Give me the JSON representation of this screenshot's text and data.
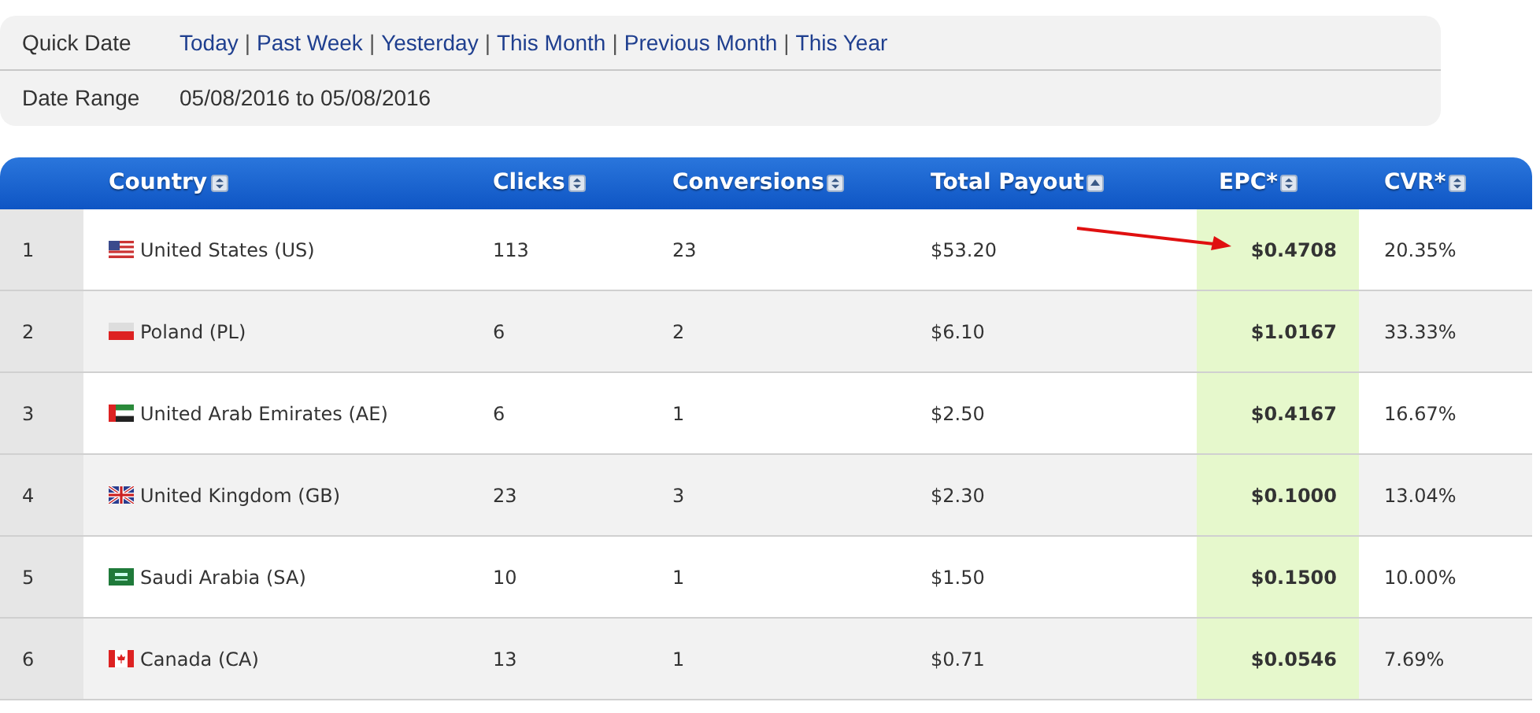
{
  "filters": {
    "quick_date": {
      "label": "Quick Date",
      "links": [
        "Today",
        "Past Week",
        "Yesterday",
        "This Month",
        "Previous Month",
        "This Year"
      ],
      "separator": "|"
    },
    "date_range": {
      "label": "Date Range",
      "value": "05/08/2016 to 05/08/2016"
    }
  },
  "table": {
    "columns": [
      {
        "label": "Country",
        "sorted": false,
        "highlighted": false
      },
      {
        "label": "Clicks",
        "sorted": false,
        "highlighted": false
      },
      {
        "label": "Conversions",
        "sorted": false,
        "highlighted": false
      },
      {
        "label": "Total Payout",
        "sorted": true,
        "highlighted": false
      },
      {
        "label": "EPC*",
        "sorted": false,
        "highlighted": true
      },
      {
        "label": "CVR*",
        "sorted": false,
        "highlighted": false
      }
    ],
    "rows": [
      {
        "rank": "1",
        "country": "United States (US)",
        "clicks": "113",
        "conversions": "23",
        "total_payout": "$53.20",
        "epc": "$0.4708",
        "cvr": "20.35%"
      },
      {
        "rank": "2",
        "country": "Poland (PL)",
        "clicks": "6",
        "conversions": "2",
        "total_payout": "$6.10",
        "epc": "$1.0167",
        "cvr": "33.33%"
      },
      {
        "rank": "3",
        "country": "United Arab Emirates (AE)",
        "clicks": "6",
        "conversions": "1",
        "total_payout": "$2.50",
        "epc": "$0.4167",
        "cvr": "16.67%"
      },
      {
        "rank": "4",
        "country": "United Kingdom (GB)",
        "clicks": "23",
        "conversions": "3",
        "total_payout": "$2.30",
        "epc": "$0.1000",
        "cvr": "13.04%"
      },
      {
        "rank": "5",
        "country": "Saudi Arabia (SA)",
        "clicks": "10",
        "conversions": "1",
        "total_payout": "$1.50",
        "epc": "$0.1500",
        "cvr": "10.00%"
      },
      {
        "rank": "6",
        "country": "Canada (CA)",
        "clicks": "13",
        "conversions": "1",
        "total_payout": "$0.71",
        "epc": "$0.0546",
        "cvr": "7.69%"
      }
    ]
  }
}
